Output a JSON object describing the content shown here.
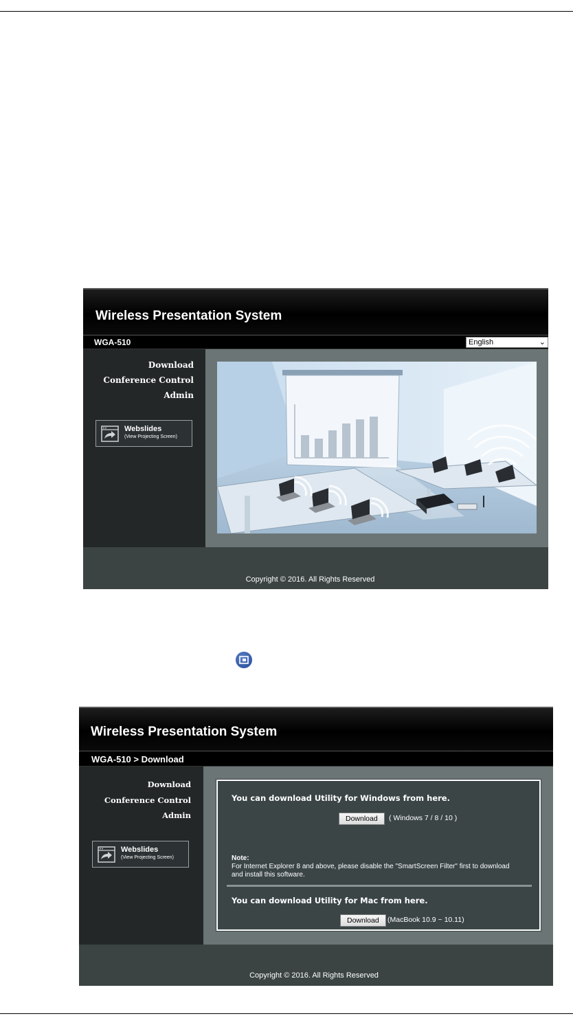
{
  "screen1": {
    "app_title": "Wireless Presentation System",
    "device_label": "WGA-510",
    "language": {
      "selected": "English"
    },
    "nav": [
      "Download",
      "Conference Control",
      "Admin"
    ],
    "webslides": {
      "title": "Webslides",
      "subtitle": "(View Projecting Screen)"
    },
    "footer": "Copyright © 2016. All Rights Reserved"
  },
  "screen2": {
    "app_title": "Wireless Presentation System",
    "breadcrumb": "WGA-510 > Download",
    "nav": [
      "Download",
      "Conference Control",
      "Admin"
    ],
    "webslides": {
      "title": "Webslides",
      "subtitle": "(View Projecting Screen)"
    },
    "windows": {
      "heading": "You can download Utility for Windows from here.",
      "button": "Download",
      "versions": "( Windows 7 / 8 / 10 )"
    },
    "note": {
      "title": "Note:",
      "text": "For Internet Explorer 8 and above, please disable the \"SmartScreen Filter\" first to download and install this software."
    },
    "mac": {
      "heading": "You can download Utility for Mac from here.",
      "button": "Download",
      "versions": "(MacBook 10.9 ~ 10.11)"
    },
    "footer": "Copyright © 2016. All Rights Reserved"
  },
  "icons": {
    "webslides": "projector-arrow-icon",
    "inline_badge": "webslides-app-icon"
  }
}
